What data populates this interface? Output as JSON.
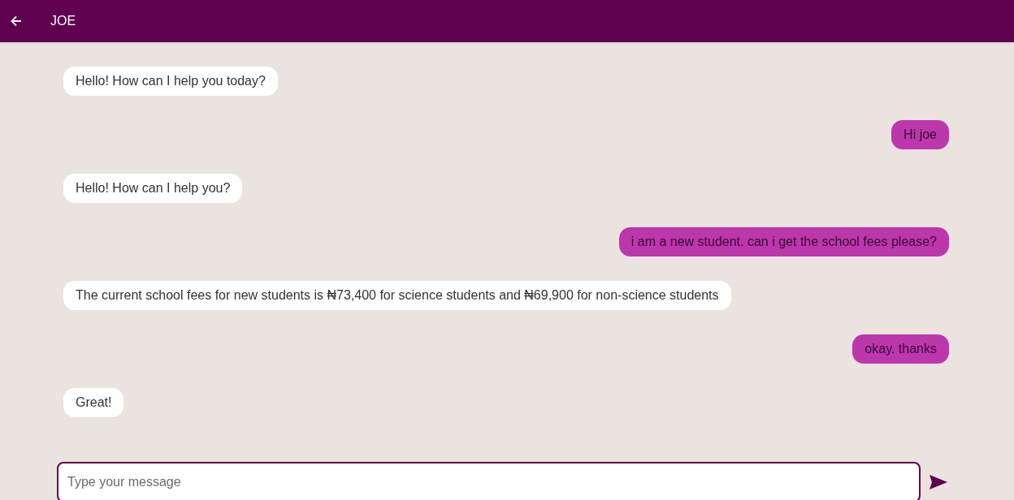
{
  "header": {
    "title": "JOE"
  },
  "messages": [
    {
      "kind": "bot",
      "text": "Hello! How can I help you today?"
    },
    {
      "kind": "user",
      "text": "Hi joe"
    },
    {
      "kind": "bot",
      "text": "Hello! How can I help you?"
    },
    {
      "kind": "user",
      "text": "i am a new student. can i get the school fees please?"
    },
    {
      "kind": "bot",
      "text": "The current school fees for new students is ₦73,400 for science students and ₦69,900 for non-science students"
    },
    {
      "kind": "user",
      "text": "okay. thanks"
    },
    {
      "kind": "bot",
      "text": "Great!"
    }
  ],
  "composer": {
    "placeholder": "Type your message"
  }
}
